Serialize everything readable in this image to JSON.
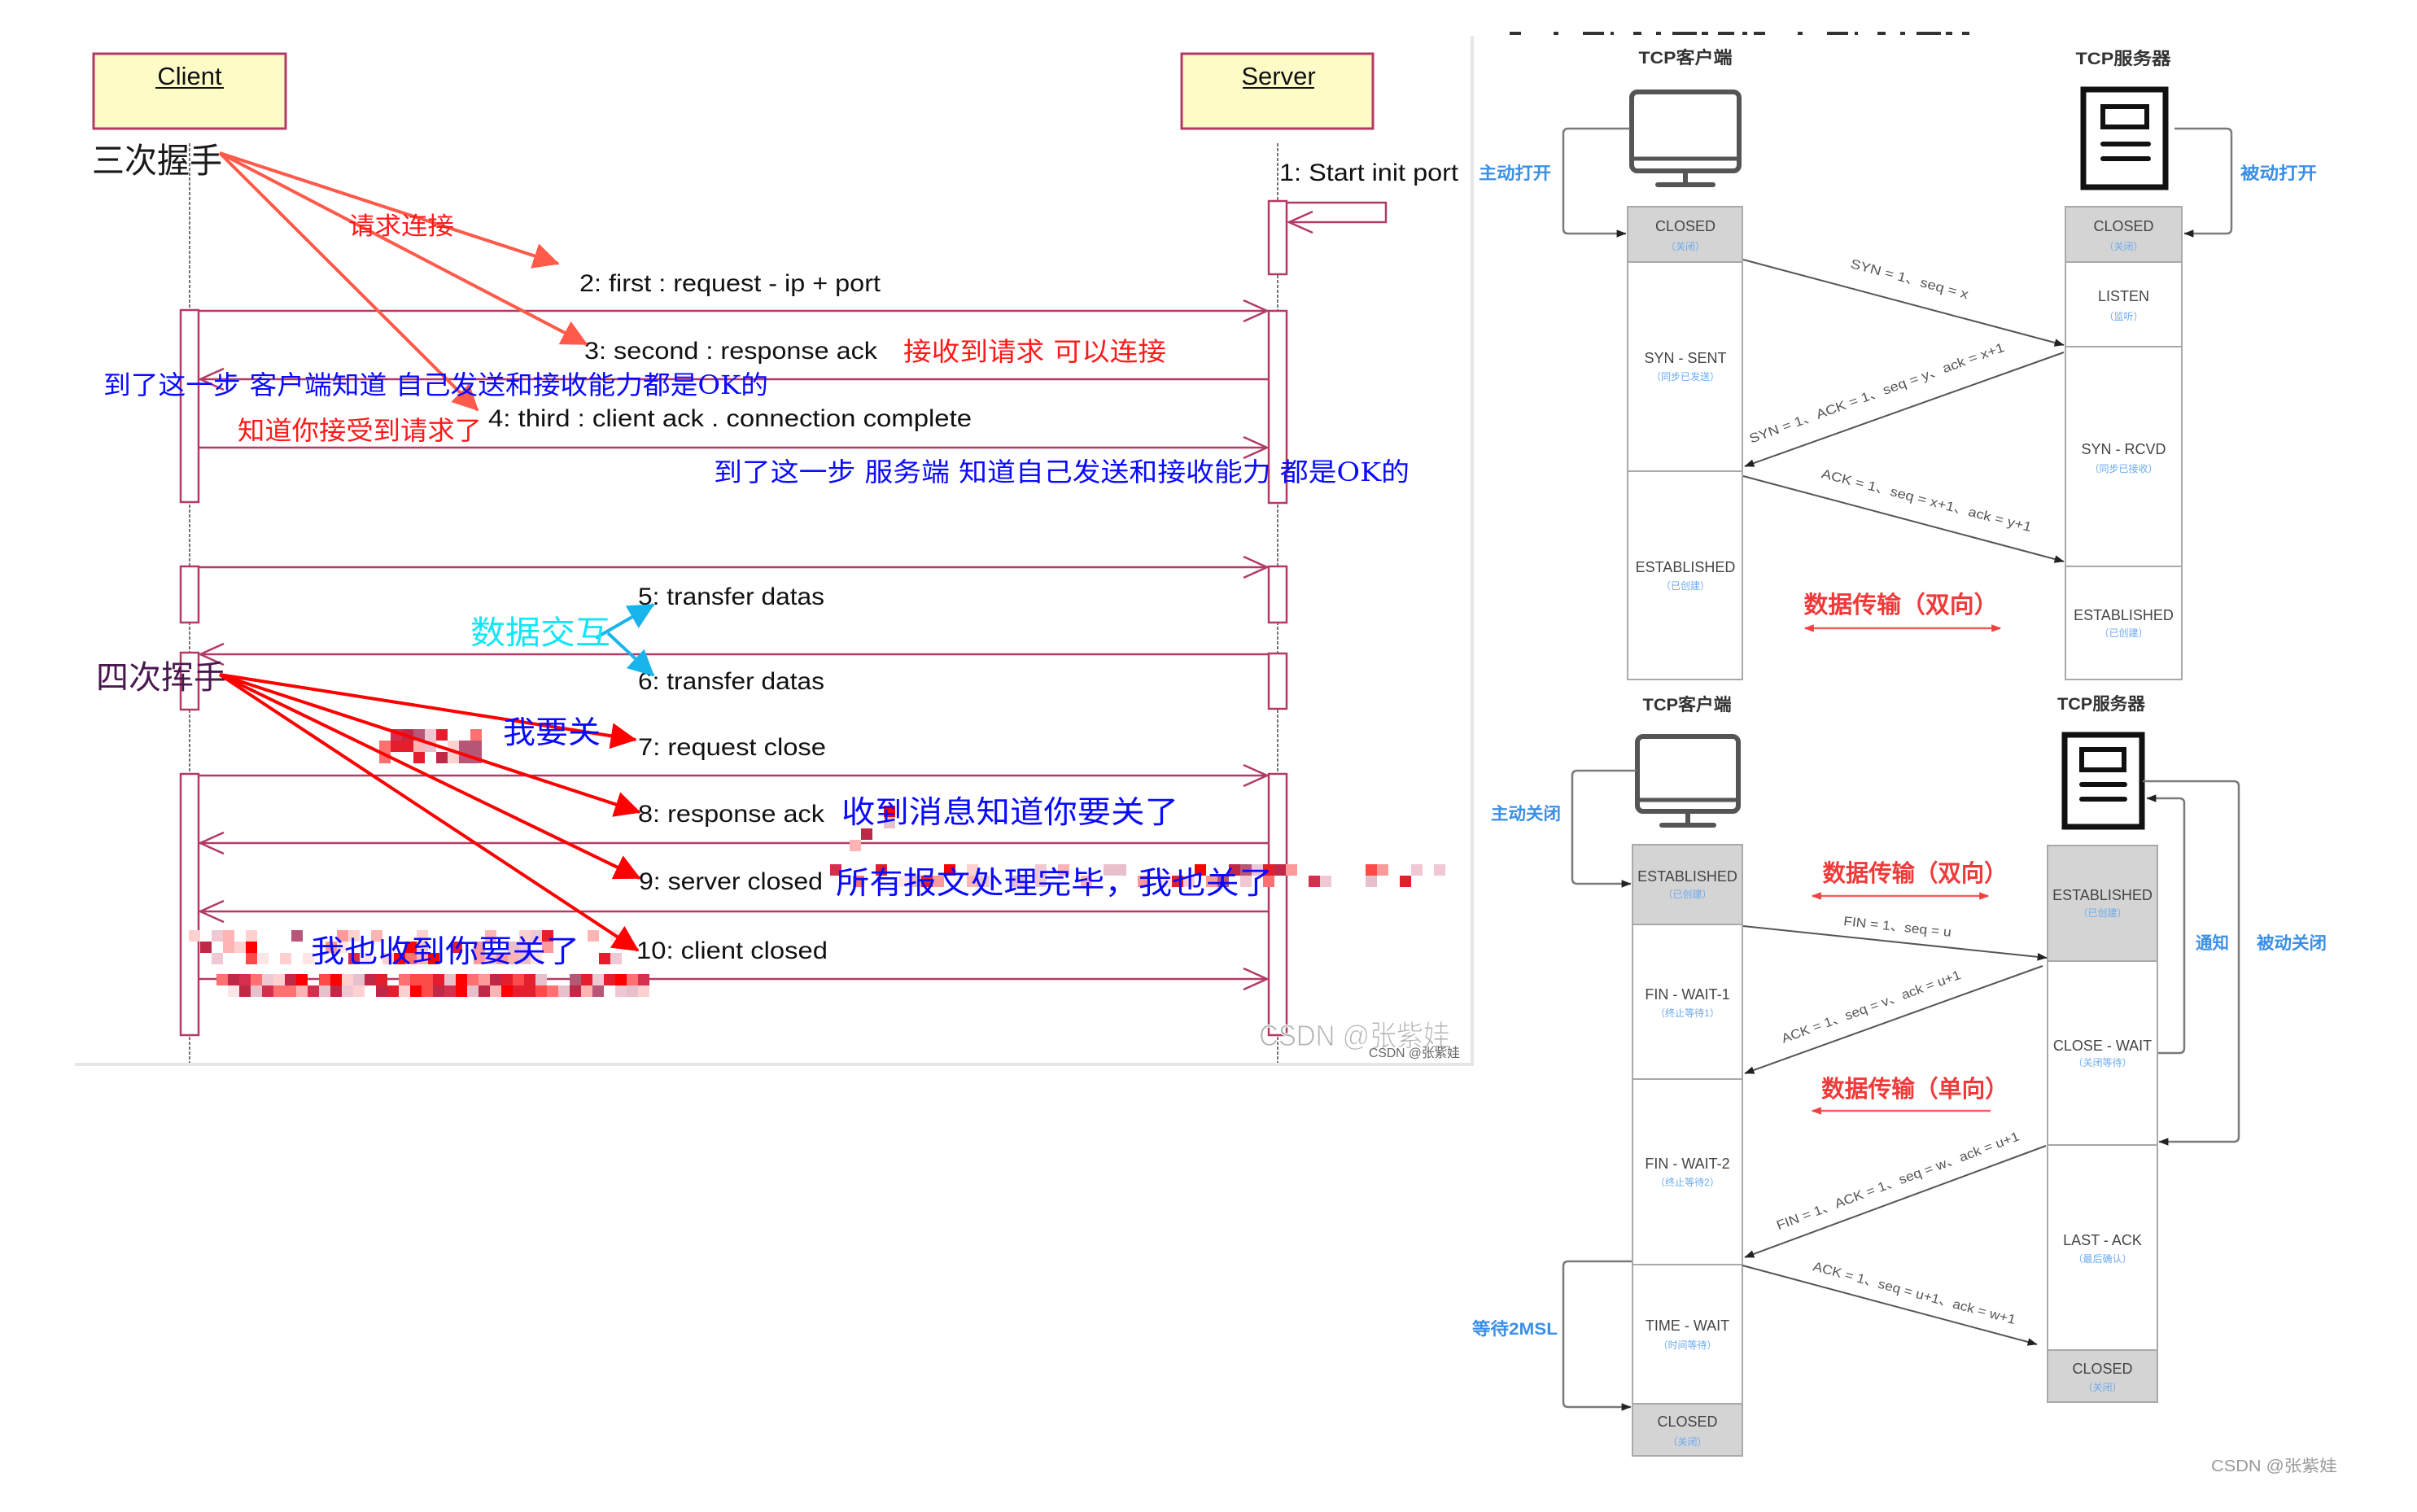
{
  "colors": {
    "uml_border": "#b33a66",
    "uml_fill": "#fdfbc6",
    "annotation_red": "#ff1a1a",
    "pointer_red_light": "#ff5a4a",
    "pointer_red": "#ff0000",
    "annotation_blue": "#0a0aff",
    "annotation_cyan": "#12e6f6",
    "pointer_cyan": "#1ab4ec",
    "phase_purple": "#4a1850",
    "state_gray": "#d4d4d4",
    "state_sublabel_blue": "#6aaaf0",
    "action_blue": "#3b8fe6",
    "transfer_red": "#f03a3a"
  },
  "sequence": {
    "participants": {
      "client": "Client",
      "server": "Server"
    },
    "phases": {
      "handshake": "三次握手",
      "teardown": "四次挥手"
    },
    "messages": [
      {
        "label": "1: Start init port",
        "from": "Server",
        "to": "Server"
      },
      {
        "label": "2: first : request - ip + port",
        "from": "Client",
        "to": "Server"
      },
      {
        "label": "3: second : response ack",
        "from": "Server",
        "to": "Client"
      },
      {
        "label": "4: third : client ack . connection complete",
        "from": "Client",
        "to": "Server"
      },
      {
        "label": "5: transfer datas",
        "from": "Client",
        "to": "Server"
      },
      {
        "label": "6: transfer datas",
        "from": "Server",
        "to": "Client"
      },
      {
        "label": "7: request close",
        "from": "Client",
        "to": "Server"
      },
      {
        "label": "8: response ack",
        "from": "Server",
        "to": "Client"
      },
      {
        "label": "9: server closed",
        "from": "Server",
        "to": "Client"
      },
      {
        "label": "10: client closed",
        "from": "Client",
        "to": "Server"
      }
    ],
    "annotations": {
      "request_connect": "请求连接",
      "server_can_connect": "接收到请求 可以连接",
      "client_capability_ok": "到了这一步 客户端知道 自己发送和接收能力都是OK的",
      "request_accepted": "知道你接受到请求了",
      "server_capability_ok": "到了这一步 服务端 知道自己发送和接收能力 都是OK的",
      "data_exchange": "数据交互",
      "want_close": "我要关",
      "ack_close": "收到消息知道你要关了",
      "server_done": "所有报文处理完毕，我也关了",
      "client_ack_close": "我也收到你要关了"
    }
  },
  "tcp_handshake": {
    "client_title": "TCP客户端",
    "server_title": "TCP服务器",
    "client_action": "主动打开",
    "server_action": "被动打开",
    "client_states": [
      {
        "name": "CLOSED",
        "cn": "（关闭）"
      },
      {
        "name": "SYN - SENT",
        "cn": "（同步已发送）"
      },
      {
        "name": "ESTABLISHED",
        "cn": "（已创建）"
      }
    ],
    "server_states": [
      {
        "name": "CLOSED",
        "cn": "（关闭）"
      },
      {
        "name": "LISTEN",
        "cn": "（监听）"
      },
      {
        "name": "SYN - RCVD",
        "cn": "（同步已接收）"
      },
      {
        "name": "ESTABLISHED",
        "cn": "（已创建）"
      }
    ],
    "packets": [
      "SYN = 1、seq = x",
      "SYN = 1、ACK = 1、seq = y、ack = x+1",
      "ACK = 1、seq = x+1、ack = y+1"
    ],
    "data_transfer": "数据传输（双向）"
  },
  "tcp_teardown": {
    "client_title": "TCP客户端",
    "server_title": "TCP服务器",
    "client_action": "主动关闭",
    "server_notify": "通知",
    "server_action": "被动关闭",
    "client_wait": "等待2MSL",
    "client_states": [
      {
        "name": "ESTABLISHED",
        "cn": "（已创建）"
      },
      {
        "name": "FIN - WAIT-1",
        "cn": "（终止等待1）"
      },
      {
        "name": "FIN - WAIT-2",
        "cn": "（终止等待2）"
      },
      {
        "name": "TIME - WAIT",
        "cn": "（时间等待）"
      },
      {
        "name": "CLOSED",
        "cn": "（关闭）"
      }
    ],
    "server_states": [
      {
        "name": "ESTABLISHED",
        "cn": "（已创建）"
      },
      {
        "name": "CLOSE - WAIT",
        "cn": "（关闭等待）"
      },
      {
        "name": "LAST - ACK",
        "cn": "（最后确认）"
      },
      {
        "name": "CLOSED",
        "cn": "（关闭）"
      }
    ],
    "packets": [
      "FIN = 1、seq = u",
      "ACK = 1、seq = v、ack = u+1",
      "FIN = 1、ACK = 1、seq = w、ack = u+1",
      "ACK = 1、seq = u+1、ack = w+1"
    ],
    "data_transfer_both": "数据传输（双向）",
    "data_transfer_one": "数据传输（单向）"
  },
  "watermarks": {
    "left_large": "CSDN @张紫娃",
    "left_small": "CSDN @张紫娃",
    "right": "CSDN @张紫娃"
  }
}
